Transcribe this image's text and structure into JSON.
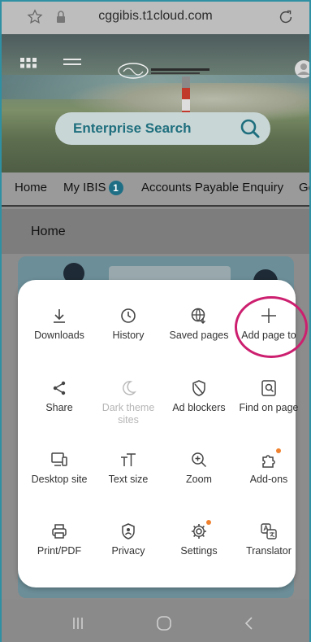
{
  "browser": {
    "url": "cggibis.t1cloud.com"
  },
  "header": {
    "search_label": "Enterprise Search"
  },
  "tabs": [
    {
      "label": "Home"
    },
    {
      "label": "My IBIS",
      "badge": "1"
    },
    {
      "label": "Accounts Payable Enquiry"
    },
    {
      "label": "Ge"
    }
  ],
  "page": {
    "title": "Home"
  },
  "menu": {
    "items": [
      {
        "label": "Downloads",
        "icon": "download-icon"
      },
      {
        "label": "History",
        "icon": "clock-icon"
      },
      {
        "label": "Saved pages",
        "icon": "globe-save-icon"
      },
      {
        "label": "Add page to",
        "icon": "plus-icon"
      },
      {
        "label": "Share",
        "icon": "share-icon"
      },
      {
        "label": "Dark theme sites",
        "icon": "moon-icon",
        "disabled": true
      },
      {
        "label": "Ad blockers",
        "icon": "shield-icon"
      },
      {
        "label": "Find on page",
        "icon": "find-icon"
      },
      {
        "label": "Desktop site",
        "icon": "desktop-icon"
      },
      {
        "label": "Text size",
        "icon": "text-size-icon"
      },
      {
        "label": "Zoom",
        "icon": "zoom-icon"
      },
      {
        "label": "Add-ons",
        "icon": "puzzle-icon"
      },
      {
        "label": "Print/PDF",
        "icon": "printer-icon"
      },
      {
        "label": "Privacy",
        "icon": "privacy-icon"
      },
      {
        "label": "Settings",
        "icon": "gear-icon"
      },
      {
        "label": "Translator",
        "icon": "translate-icon"
      }
    ]
  },
  "colors": {
    "accent": "#1f6f7e",
    "highlight": "#cc1f6f",
    "notification_dot": "#f0822f"
  }
}
